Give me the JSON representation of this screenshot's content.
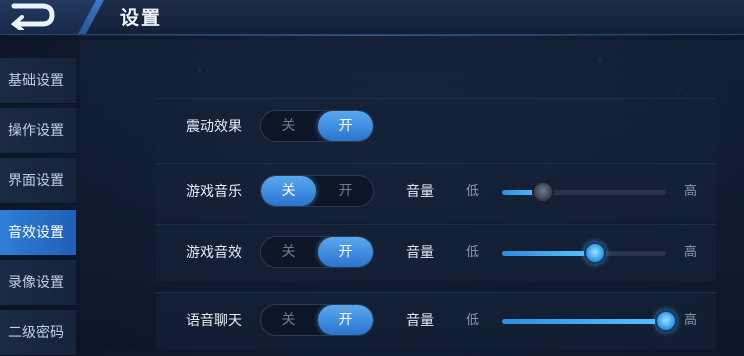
{
  "header": {
    "title": "设置"
  },
  "sidebar": {
    "items": [
      {
        "label": "基础设置",
        "active": false
      },
      {
        "label": "操作设置",
        "active": false
      },
      {
        "label": "界面设置",
        "active": false
      },
      {
        "label": "音效设置",
        "active": true
      },
      {
        "label": "录像设置",
        "active": false
      },
      {
        "label": "二级密码",
        "active": false
      }
    ]
  },
  "toggle_labels": {
    "off": "关",
    "on": "开"
  },
  "rows": [
    {
      "label": "震动效果",
      "state": "on"
    },
    {
      "label": "游戏音乐",
      "state": "off",
      "volume_label": "音量",
      "low": "低",
      "high": "高",
      "volume": 0.25
    },
    {
      "label": "游戏音效",
      "state": "on",
      "volume_label": "音量",
      "low": "低",
      "high": "高",
      "volume": 0.57
    },
    {
      "label": "语音聊天",
      "state": "on",
      "volume_label": "音量",
      "low": "低",
      "high": "高",
      "volume": 1.0
    }
  ],
  "colors": {
    "accent": "#2f7fd6",
    "active_toggle": "#3a8ae0",
    "background": "#0f1a2e"
  }
}
